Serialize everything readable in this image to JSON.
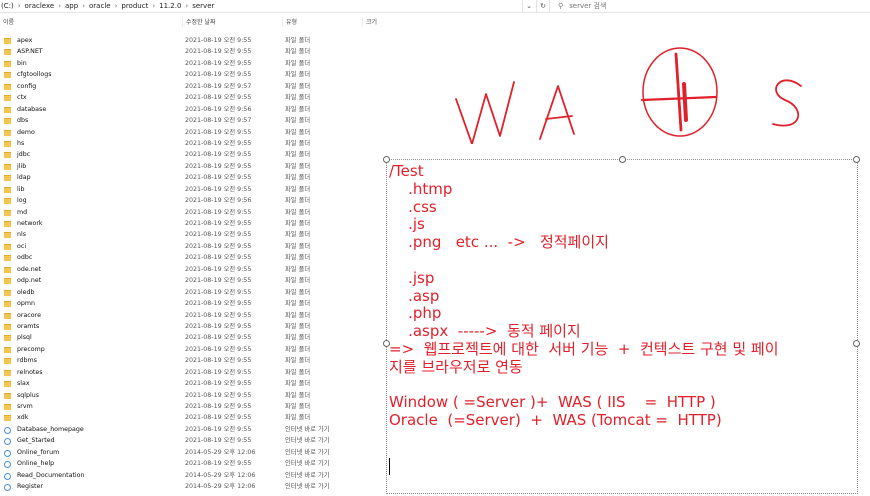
{
  "address": {
    "segments": [
      "(C:)",
      "oraclexe",
      "app",
      "oracle",
      "product",
      "11.2.0",
      "server"
    ],
    "search_placeholder": "server 검색"
  },
  "columns": {
    "name": "이름",
    "date": "수정한 날짜",
    "type": "유형",
    "size": "크기"
  },
  "files": [
    {
      "name": "apex",
      "date": "2021-08-19 오전 9:55",
      "type": "파일 폴더",
      "icon": "folder-icon"
    },
    {
      "name": "ASP.NET",
      "date": "2021-08-19 오전 9:55",
      "type": "파일 폴더",
      "icon": "folder-icon"
    },
    {
      "name": "bin",
      "date": "2021-08-19 오전 9:55",
      "type": "파일 폴더",
      "icon": "folder-icon"
    },
    {
      "name": "cfgtoollogs",
      "date": "2021-08-19 오전 9:55",
      "type": "파일 폴더",
      "icon": "folder-icon"
    },
    {
      "name": "config",
      "date": "2021-08-19 오전 9:57",
      "type": "파일 폴더",
      "icon": "folder-icon"
    },
    {
      "name": "ctx",
      "date": "2021-08-19 오전 9:55",
      "type": "파일 폴더",
      "icon": "folder-icon"
    },
    {
      "name": "database",
      "date": "2021-08-19 오전 9:56",
      "type": "파일 폴더",
      "icon": "folder-icon"
    },
    {
      "name": "dbs",
      "date": "2021-08-19 오전 9:57",
      "type": "파일 폴더",
      "icon": "folder-icon"
    },
    {
      "name": "demo",
      "date": "2021-08-19 오전 9:55",
      "type": "파일 폴더",
      "icon": "folder-icon"
    },
    {
      "name": "hs",
      "date": "2021-08-19 오전 9:55",
      "type": "파일 폴더",
      "icon": "folder-icon"
    },
    {
      "name": "jdbc",
      "date": "2021-08-19 오전 9:55",
      "type": "파일 폴더",
      "icon": "folder-icon"
    },
    {
      "name": "jlib",
      "date": "2021-08-19 오전 9:55",
      "type": "파일 폴더",
      "icon": "folder-icon"
    },
    {
      "name": "ldap",
      "date": "2021-08-19 오전 9:55",
      "type": "파일 폴더",
      "icon": "folder-icon"
    },
    {
      "name": "lib",
      "date": "2021-08-19 오전 9:55",
      "type": "파일 폴더",
      "icon": "folder-icon"
    },
    {
      "name": "log",
      "date": "2021-08-19 오전 9:56",
      "type": "파일 폴더",
      "icon": "folder-icon"
    },
    {
      "name": "md",
      "date": "2021-08-19 오전 9:55",
      "type": "파일 폴더",
      "icon": "folder-icon"
    },
    {
      "name": "network",
      "date": "2021-08-19 오전 9:55",
      "type": "파일 폴더",
      "icon": "folder-icon"
    },
    {
      "name": "nls",
      "date": "2021-08-19 오전 9:55",
      "type": "파일 폴더",
      "icon": "folder-icon"
    },
    {
      "name": "oci",
      "date": "2021-08-19 오전 9:55",
      "type": "파일 폴더",
      "icon": "folder-icon"
    },
    {
      "name": "odbc",
      "date": "2021-08-19 오전 9:55",
      "type": "파일 폴더",
      "icon": "folder-icon"
    },
    {
      "name": "ode.net",
      "date": "2021-08-19 오전 9:55",
      "type": "파일 폴더",
      "icon": "folder-icon"
    },
    {
      "name": "odp.net",
      "date": "2021-08-19 오전 9:55",
      "type": "파일 폴더",
      "icon": "folder-icon"
    },
    {
      "name": "oledb",
      "date": "2021-08-19 오전 9:55",
      "type": "파일 폴더",
      "icon": "folder-icon"
    },
    {
      "name": "opmn",
      "date": "2021-08-19 오전 9:55",
      "type": "파일 폴더",
      "icon": "folder-icon"
    },
    {
      "name": "oracore",
      "date": "2021-08-19 오전 9:55",
      "type": "파일 폴더",
      "icon": "folder-icon"
    },
    {
      "name": "oramts",
      "date": "2021-08-19 오전 9:55",
      "type": "파일 폴더",
      "icon": "folder-icon"
    },
    {
      "name": "plsql",
      "date": "2021-08-19 오전 9:55",
      "type": "파일 폴더",
      "icon": "folder-icon"
    },
    {
      "name": "precomp",
      "date": "2021-08-19 오전 9:55",
      "type": "파일 폴더",
      "icon": "folder-icon"
    },
    {
      "name": "rdbms",
      "date": "2021-08-19 오전 9:55",
      "type": "파일 폴더",
      "icon": "folder-icon"
    },
    {
      "name": "relnotes",
      "date": "2021-08-19 오전 9:55",
      "type": "파일 폴더",
      "icon": "folder-icon"
    },
    {
      "name": "slax",
      "date": "2021-08-19 오전 9:55",
      "type": "파일 폴더",
      "icon": "folder-icon"
    },
    {
      "name": "sqlplus",
      "date": "2021-08-19 오전 9:55",
      "type": "파일 폴더",
      "icon": "folder-icon"
    },
    {
      "name": "srvm",
      "date": "2021-08-19 오전 9:55",
      "type": "파일 폴더",
      "icon": "folder-icon"
    },
    {
      "name": "xdk",
      "date": "2021-08-19 오전 9:55",
      "type": "파일 폴더",
      "icon": "folder-icon"
    },
    {
      "name": "Database_homepage",
      "date": "2021-08-19 오전 9:55",
      "type": "인터넷 바로 가기",
      "icon": "internet-shortcut-icon"
    },
    {
      "name": "Get_Started",
      "date": "2021-08-19 오전 9:55",
      "type": "인터넷 바로 가기",
      "icon": "internet-shortcut-icon"
    },
    {
      "name": "Online_forum",
      "date": "2014-05-29 오후 12:06",
      "type": "인터넷 바로 가기",
      "icon": "internet-shortcut-icon"
    },
    {
      "name": "Online_help",
      "date": "2021-08-19 오전 9:55",
      "type": "인터넷 바로 가기",
      "icon": "internet-shortcut-icon"
    },
    {
      "name": "Read_Documentation",
      "date": "2014-05-29 오후 12:06",
      "type": "인터넷 바로 가기",
      "icon": "internet-shortcut-icon"
    },
    {
      "name": "Register",
      "date": "2014-05-29 오후 12:06",
      "type": "인터넷 바로 가기",
      "icon": "internet-shortcut-icon"
    }
  ],
  "handwriting": {
    "text": "WAS",
    "color": "#e0212b"
  },
  "note": {
    "color": "#e0212b",
    "lines": [
      "/Test",
      "    .htmp",
      "    .css",
      "    .js",
      "    .png   etc ...  ->   정적페이지",
      "",
      "    .jsp",
      "    .asp",
      "    .php",
      "    .aspx  ----->  동적 페이지",
      "=>  웹프로젝트에 대한  서버 기능  +  컨텍스트 구현 및 페이",
      "지를 브라우저로 연동",
      "",
      "Window ( =Server )+  WAS ( IIS    =  HTTP )",
      "Oracle  (=Server)  +  WAS (Tomcat =  HTTP)"
    ]
  }
}
